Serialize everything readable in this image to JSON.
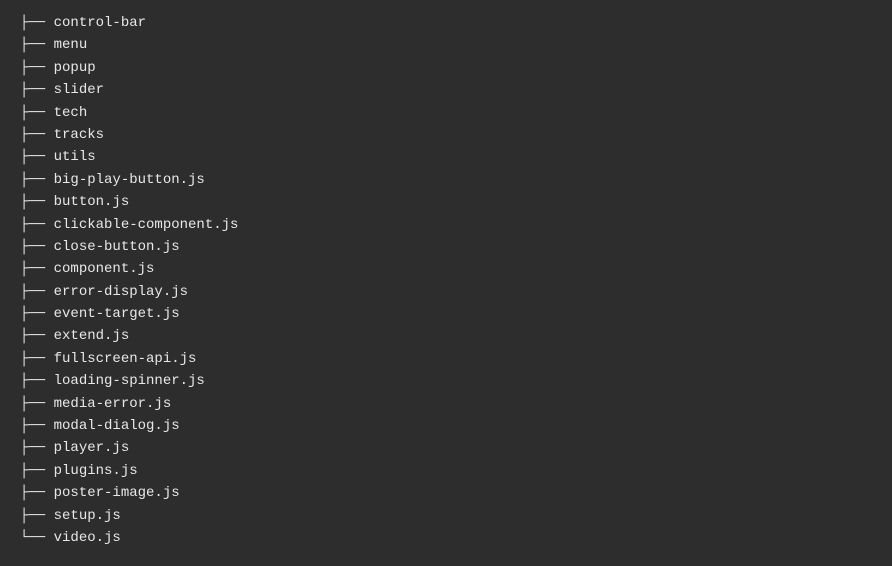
{
  "tree": {
    "items": [
      {
        "prefix": "├── ",
        "name": "control-bar"
      },
      {
        "prefix": "├── ",
        "name": "menu"
      },
      {
        "prefix": "├── ",
        "name": "popup"
      },
      {
        "prefix": "├── ",
        "name": "slider"
      },
      {
        "prefix": "├── ",
        "name": "tech"
      },
      {
        "prefix": "├── ",
        "name": "tracks"
      },
      {
        "prefix": "├── ",
        "name": "utils"
      },
      {
        "prefix": "├── ",
        "name": "big-play-button.js"
      },
      {
        "prefix": "├── ",
        "name": "button.js"
      },
      {
        "prefix": "├── ",
        "name": "clickable-component.js"
      },
      {
        "prefix": "├── ",
        "name": "close-button.js"
      },
      {
        "prefix": "├── ",
        "name": "component.js"
      },
      {
        "prefix": "├── ",
        "name": "error-display.js"
      },
      {
        "prefix": "├── ",
        "name": "event-target.js"
      },
      {
        "prefix": "├── ",
        "name": "extend.js"
      },
      {
        "prefix": "├── ",
        "name": "fullscreen-api.js"
      },
      {
        "prefix": "├── ",
        "name": "loading-spinner.js"
      },
      {
        "prefix": "├── ",
        "name": "media-error.js"
      },
      {
        "prefix": "├── ",
        "name": "modal-dialog.js"
      },
      {
        "prefix": "├── ",
        "name": "player.js"
      },
      {
        "prefix": "├── ",
        "name": "plugins.js"
      },
      {
        "prefix": "├── ",
        "name": "poster-image.js"
      },
      {
        "prefix": "├── ",
        "name": "setup.js"
      },
      {
        "prefix": "└── ",
        "name": "video.js"
      }
    ]
  }
}
